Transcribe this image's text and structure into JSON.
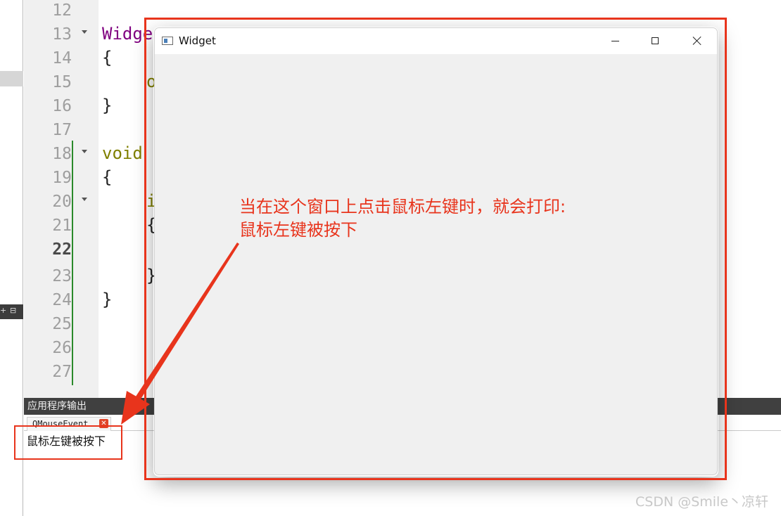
{
  "editor": {
    "line_numbers": [
      "12",
      "13",
      "14",
      "15",
      "16",
      "17",
      "18",
      "19",
      "20",
      "21",
      "22",
      "23",
      "24",
      "25",
      "26",
      "27"
    ],
    "current_line": "22",
    "code": {
      "l13": "Widge",
      "l14": "{",
      "l15": "o",
      "l16": "}",
      "l18": "void",
      "l19": "{",
      "l20": "i",
      "l21": "{",
      "l23": "}",
      "l24": "}"
    }
  },
  "output_pane": {
    "title": "应用程序输出",
    "tab_label": "QMouseEvent",
    "text": "鼠标左键被按下"
  },
  "widget_window": {
    "title": "Widget"
  },
  "annotation": {
    "line1": "当在这个窗口上点击鼠标左键时，就会打印:",
    "line2": "鼠标左键被按下"
  },
  "watermark": "CSDN @Smile丶凉轩",
  "colors": {
    "annotation_red": "#e8341c",
    "keyword": "#808000",
    "type": "#800080",
    "change_marker": "#2b8a2b"
  }
}
